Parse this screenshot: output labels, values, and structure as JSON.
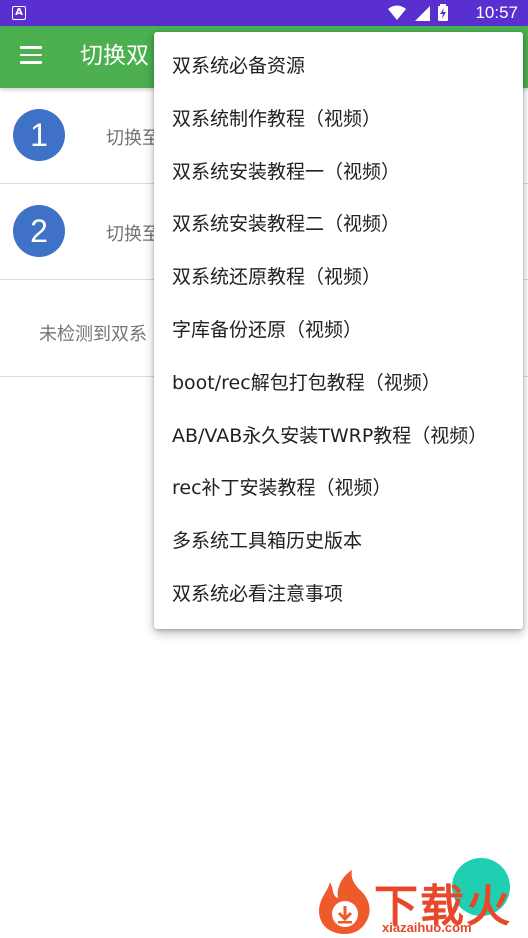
{
  "status_bar": {
    "notification_glyph": "A",
    "time": "10:57",
    "icons": [
      "wifi-icon",
      "signal-icon",
      "battery-charging-icon"
    ]
  },
  "app_bar": {
    "title": "切换双",
    "menu_icon": "menu-icon",
    "color": "#4caf50"
  },
  "main": {
    "rows": [
      {
        "number": "1",
        "label": "切换至"
      },
      {
        "number": "2",
        "label": "切换至"
      }
    ],
    "info_text": "未检测到双系"
  },
  "popup_menu": {
    "items": [
      "双系统必备资源",
      "双系统制作教程（视频）",
      "双系统安装教程一（视频）",
      "双系统安装教程二（视频）",
      "双系统还原教程（视频）",
      "字库备份还原（视频）",
      "boot/rec解包打包教程（视频）",
      "AB/VAB永久安装TWRP教程（视频）",
      "rec补丁安装教程（视频）",
      "多系统工具箱历史版本",
      "双系统必看注意事项"
    ]
  },
  "watermark": {
    "main": "下载火",
    "sub": "xiazaihuo.com",
    "color": "#e8472a"
  },
  "colors": {
    "status_bar": "#5a2fd0",
    "accent_circle": "#3f72c6",
    "fab": "#1fcfb1"
  }
}
